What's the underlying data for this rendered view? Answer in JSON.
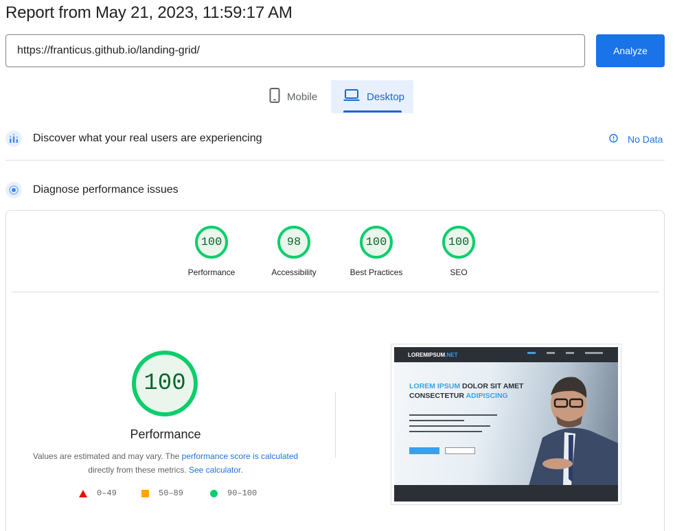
{
  "header": {
    "title": "Report from May 21, 2023, 11:59:17 AM"
  },
  "search": {
    "url": "https://franticus.github.io/landing-grid/",
    "analyze_label": "Analyze"
  },
  "tabs": [
    {
      "label": "Mobile"
    },
    {
      "label": "Desktop",
      "active": true
    }
  ],
  "field_data": {
    "title": "Discover what your real users are experiencing",
    "status": "No Data"
  },
  "lab": {
    "title": "Diagnose performance issues",
    "categories": [
      {
        "name": "Performance",
        "score": "100"
      },
      {
        "name": "Accessibility",
        "score": "98"
      },
      {
        "name": "Best Practices",
        "score": "100"
      },
      {
        "name": "SEO",
        "score": "100"
      }
    ],
    "main_score": "100",
    "main_label": "Performance",
    "desc_prefix": "Values are estimated and may vary. The ",
    "desc_link1": "performance score is calculated",
    "desc_mid": "directly from these metrics. ",
    "desc_link2": "See calculator.",
    "legend": {
      "fail": "0–49",
      "average": "50–89",
      "pass": "90–100"
    }
  },
  "screenshot": {
    "logo": "LOREMIPSUM",
    "logo_suffix": ".NET",
    "headline_blue1": "LOREM IPSUM",
    "headline_dark1": " DOLOR SIT AMET",
    "headline_dark2": "CONSECTETUR ",
    "headline_blue2": "ADIPISCING"
  },
  "colors": {
    "accent": "#1a73e8",
    "pass": "#0cce6b",
    "average": "#ffa400",
    "fail": "#eb0f00",
    "tab_bg": "#e8f0fe"
  }
}
